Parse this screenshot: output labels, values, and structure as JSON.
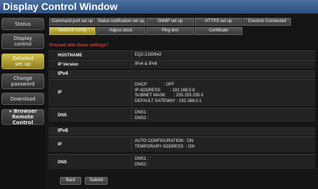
{
  "window": {
    "title": "Display Control Window"
  },
  "sidebar": {
    "items": [
      {
        "label": "Status",
        "active": false
      },
      {
        "label": "Display\ncontrol",
        "active": false
      },
      {
        "label": "Detailed\nset up",
        "active": true
      },
      {
        "label": "Change\npassword",
        "active": false
      },
      {
        "label": "Download",
        "active": false
      },
      {
        "label": "» Browser\nRemote Control",
        "active": false
      }
    ]
  },
  "tabs": {
    "row1": [
      "Command port set up",
      "Status notification set up",
      "SNMP set up",
      "HTTPS set up",
      "Crestron Connected"
    ],
    "row2": [
      "Network config",
      "Adjust clock",
      "Ping test",
      "Certificate"
    ],
    "active": "Network config"
  },
  "warning": "Proceed with these settings?",
  "summary": {
    "hostname_label": "HOSTNAME",
    "hostname_value": "EQ2-2150642",
    "ipversion_label": "IP Version",
    "ipversion_value": "IPv4 & IPv6"
  },
  "ipv4": {
    "heading": "IPv4",
    "ip_label": "IP",
    "ip_lines": [
      "DHCP              : OFF",
      "IP ADDRESS        : 192.168.0.8",
      "SUBNET MASK       : 255.255.255.0",
      "DEFAULT GATEWAY : 192.168.0.1"
    ],
    "dns_label": "DNS",
    "dns_lines": [
      "DNS1 :",
      "DNS2 :"
    ]
  },
  "ipv6": {
    "heading": "IPv6",
    "ip_label": "IP",
    "ip_lines": [
      "AUTO CONFIGURATION : ON",
      "TEMPORARY ADDRESS  : ON"
    ],
    "dns_label": "DNS",
    "dns_lines": [
      "DNS1 :",
      "DNS2 :"
    ]
  },
  "buttons": {
    "back": "Back",
    "submit": "Submit"
  },
  "colors": {
    "accent_active": "#c8b640",
    "warning": "#e03a3a",
    "title_bar": "#3a5f90"
  }
}
